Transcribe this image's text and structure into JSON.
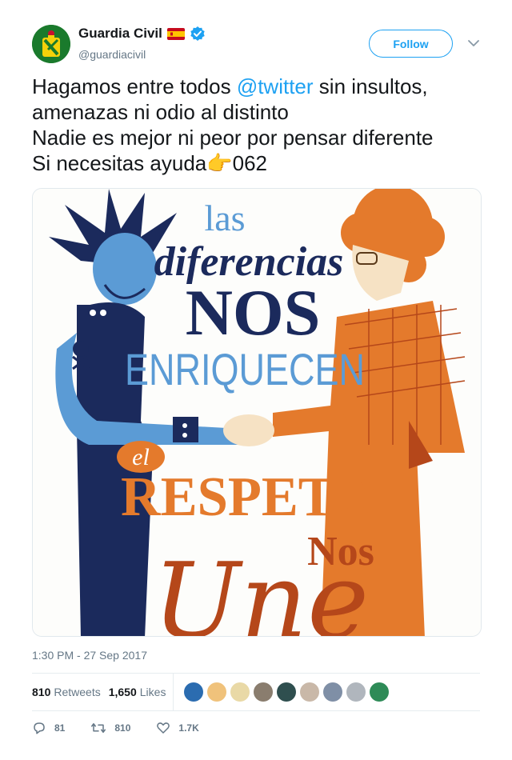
{
  "account": {
    "name": "Guardia Civil",
    "handle": "@guardiacivil",
    "verified": true,
    "flag": "spain-flag",
    "follow_label": "Follow"
  },
  "tweet": {
    "line1_before": "Hagamos entre todos ",
    "line1_mention": "@twitter",
    "line1_after": " sin insultos,",
    "line2": "amenazas ni odio al distinto",
    "line3": "Nadie es mejor ni peor por pensar diferente",
    "line4_text": "Si necesitas ayuda",
    "line4_emoji": "👉",
    "line4_number": "062"
  },
  "media": {
    "poster_text": {
      "las": "las",
      "diferencias": "diferencias",
      "nos": "NOS",
      "enriquecen": "ENRIQUECEN",
      "el": "el",
      "respeto": "RESPETO",
      "nos2": "Nos",
      "une": "Une"
    },
    "colors": {
      "navy": "#1b2a5c",
      "light_blue": "#5b9bd5",
      "orange": "#e47a2c",
      "dark_orange": "#b5471a"
    }
  },
  "meta": {
    "timestamp": "1:30 PM - 27 Sep 2017"
  },
  "stats": {
    "retweets_count": "810",
    "retweets_label": "Retweets",
    "likes_count": "1,650",
    "likes_label": "Likes"
  },
  "actions": {
    "replies": "81",
    "retweets": "810",
    "likes": "1.7K"
  },
  "liker_avatars": [
    "#2b6cb0",
    "#f0c27b",
    "#e9d9a6",
    "#8a7d6e",
    "#2f4f4f",
    "#c9b8a8",
    "#7f8fa6",
    "#b0b6bd",
    "#2e8b57"
  ]
}
